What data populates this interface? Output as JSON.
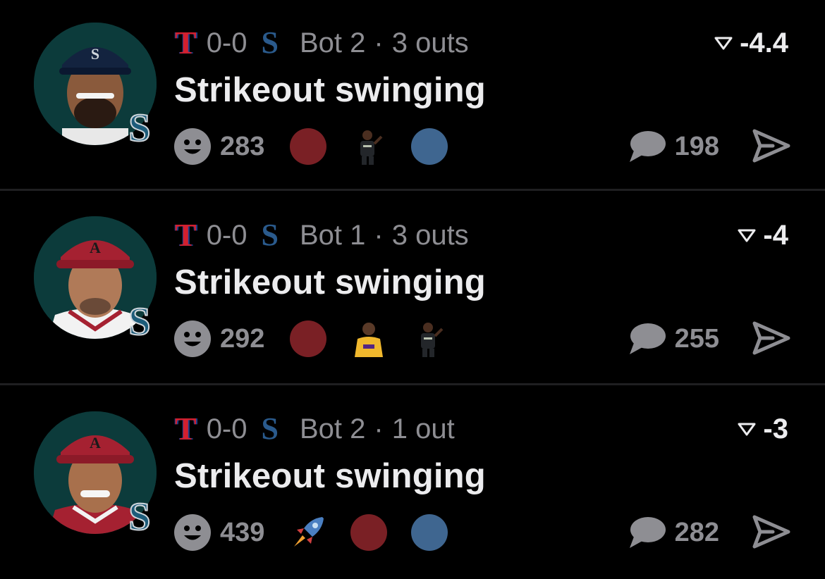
{
  "feed": {
    "items": [
      {
        "away_team": "T",
        "score": "0-0",
        "home_team": "S",
        "inning": "Bot 2",
        "separator": "·",
        "outs": "3 outs",
        "headline": "Strikeout swinging",
        "delta": "-4.4",
        "reaction_count": "283",
        "comment_count": "198",
        "avatar_cap": "seattle-mariners-cap",
        "reactions": [
          "red-circle",
          "player-emoji",
          "blue-circle"
        ]
      },
      {
        "away_team": "T",
        "score": "0-0",
        "home_team": "S",
        "inning": "Bot 1",
        "separator": "·",
        "outs": "3 outs",
        "headline": "Strikeout swinging",
        "delta": "-4",
        "reaction_count": "292",
        "comment_count": "255",
        "avatar_cap": "arizona-diamondbacks-cap",
        "reactions": [
          "red-circle",
          "player-emoji-lakers",
          "player-emoji"
        ]
      },
      {
        "away_team": "T",
        "score": "0-0",
        "home_team": "S",
        "inning": "Bot 2",
        "separator": "·",
        "outs": "1 out",
        "headline": "Strikeout swinging",
        "delta": "-3",
        "reaction_count": "439",
        "comment_count": "282",
        "avatar_cap": "arizona-diamondbacks-cap",
        "reactions": [
          "rocket",
          "red-circle",
          "blue-circle"
        ]
      }
    ]
  },
  "colors": {
    "background": "#000000",
    "text_primary": "#ececee",
    "text_secondary": "#8e8e93",
    "reaction_red": "#7a2025",
    "reaction_blue": "#3f6690",
    "rangers_red": "#d2202f",
    "mariners_navy": "#2a5a8c"
  }
}
